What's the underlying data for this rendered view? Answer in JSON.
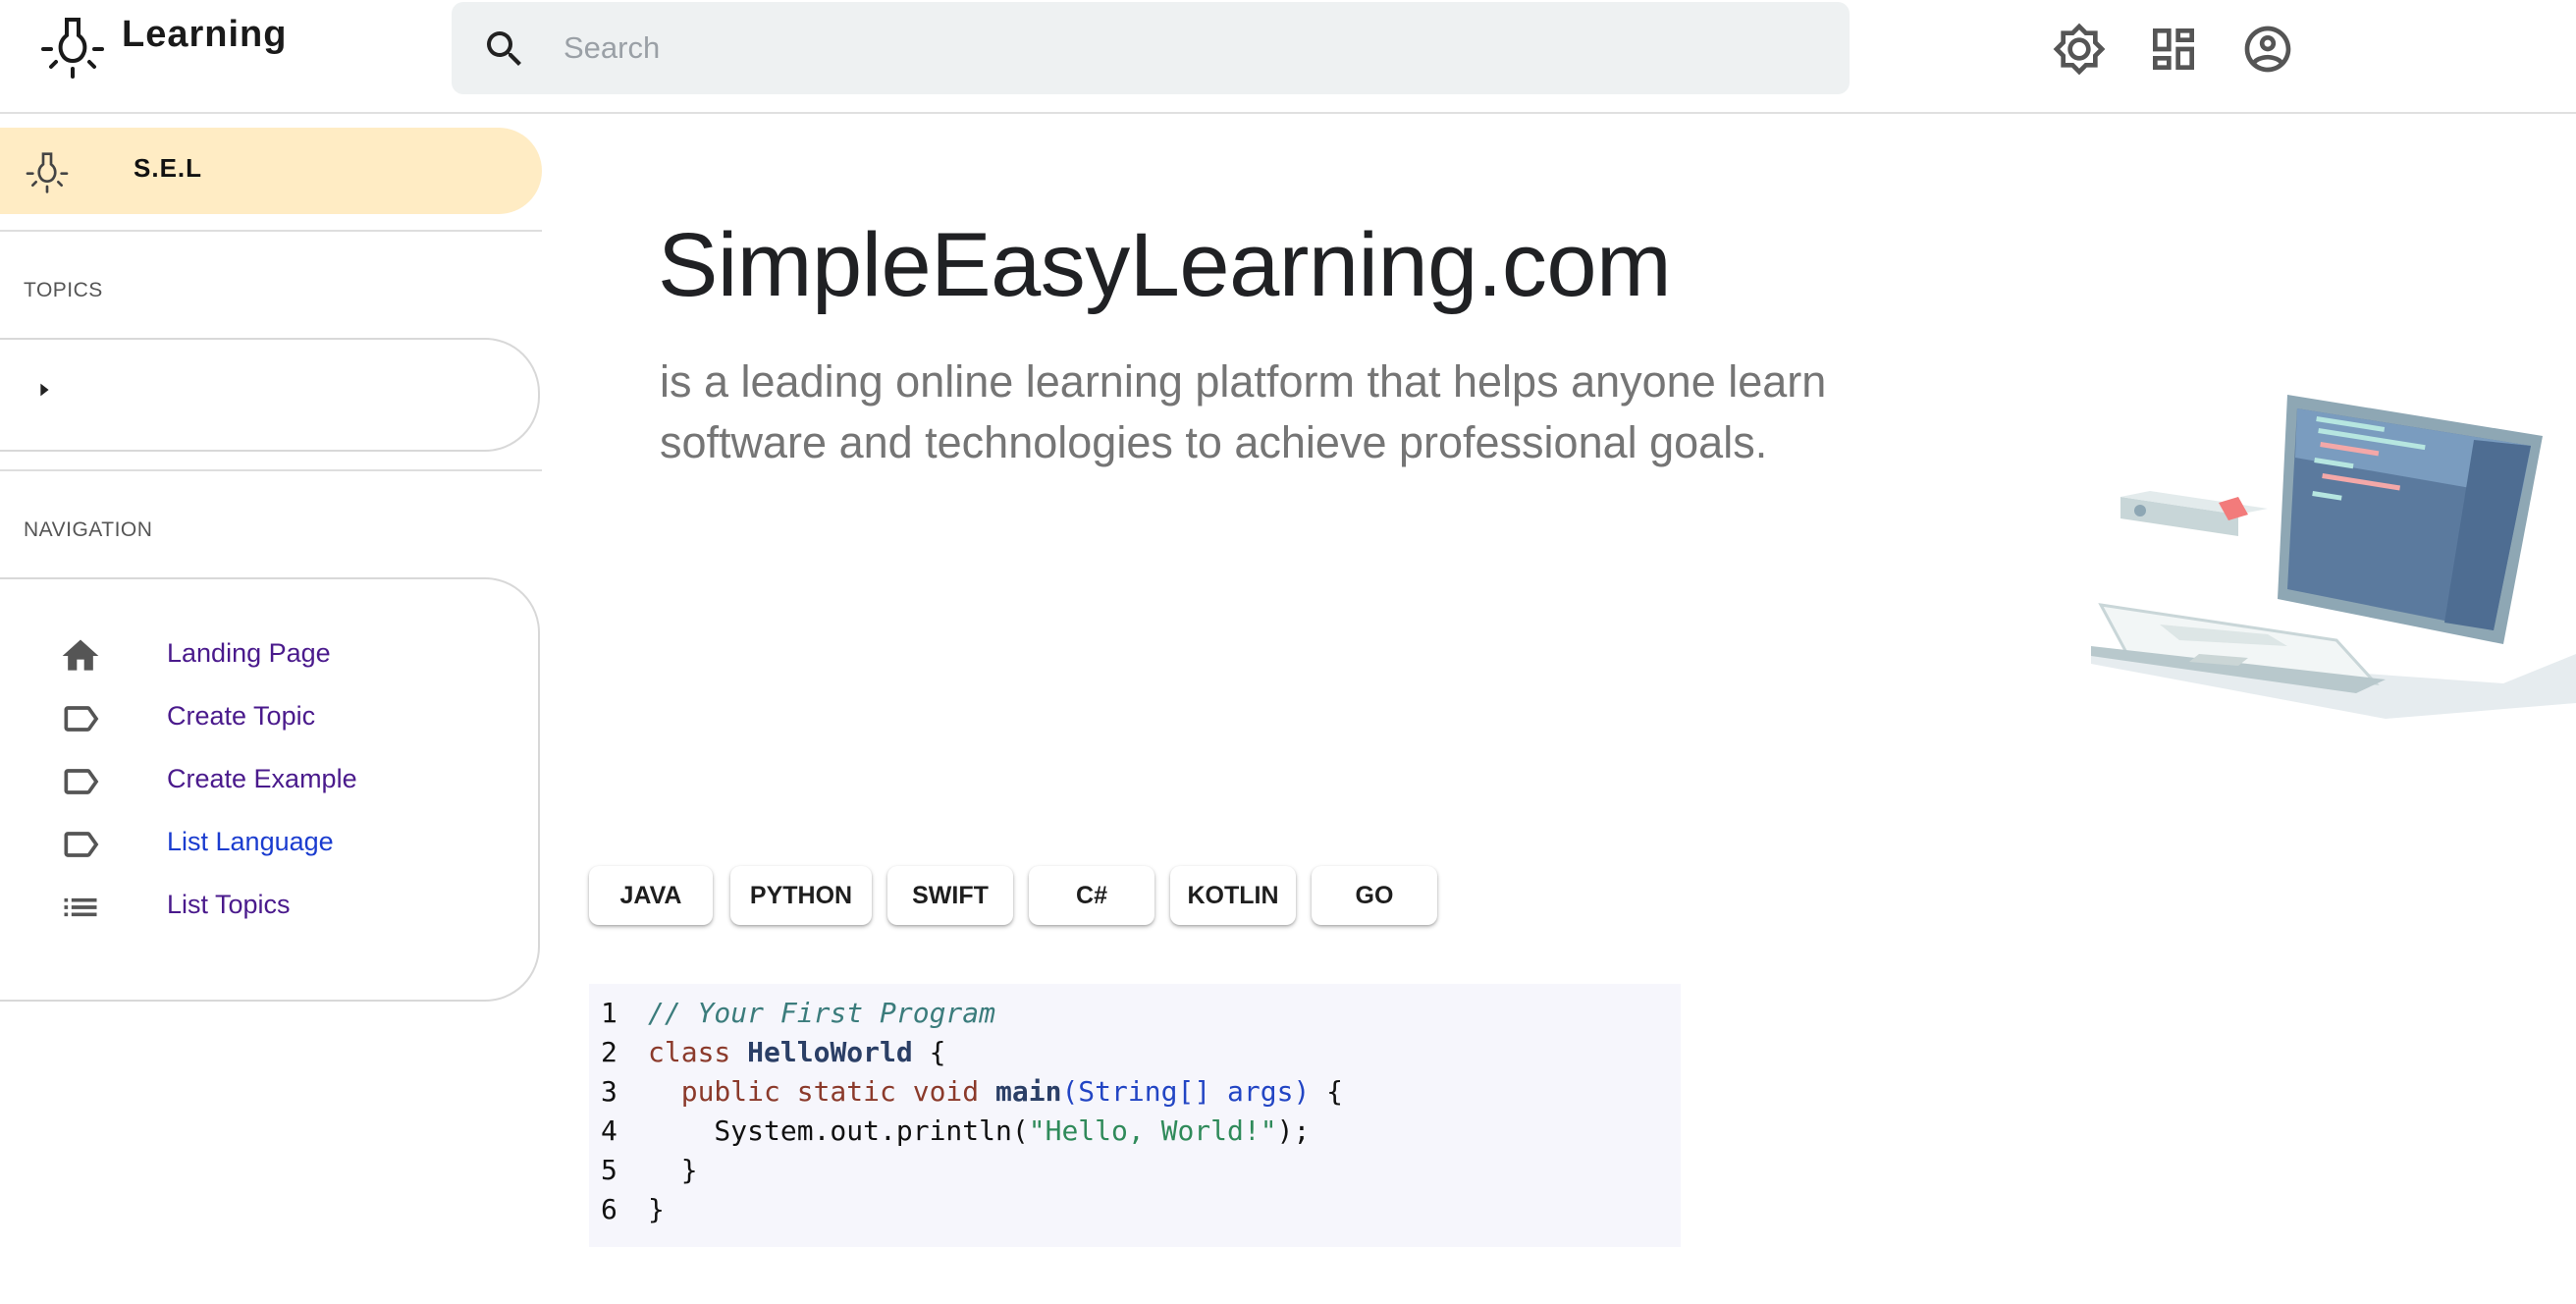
{
  "header": {
    "app_name": "Learning",
    "search": {
      "placeholder": "Search",
      "value": ""
    },
    "icons": [
      "lightbulb-icon",
      "search-icon",
      "brightness-icon",
      "dashboard-icon",
      "account-circle-icon"
    ]
  },
  "sidebar": {
    "brand": {
      "label": "S.E.L",
      "icon": "lightbulb-icon"
    },
    "topics_title": "TOPICS",
    "navigation_title": "NAVIGATION",
    "nav_items": [
      {
        "label": "Landing Page",
        "icon": "home-icon"
      },
      {
        "label": "Create Topic",
        "icon": "label-icon"
      },
      {
        "label": "Create Example",
        "icon": "label-icon"
      },
      {
        "label": "List Language",
        "icon": "label-icon"
      },
      {
        "label": "List Topics",
        "icon": "list-icon"
      }
    ]
  },
  "main": {
    "title": "SimpleEasyLearning.com",
    "subtitle_line1": "is a leading online learning platform that helps anyone learn",
    "subtitle_line2": "software and technologies to achieve professional goals.",
    "languages": [
      "JAVA",
      "PYTHON",
      "SWIFT",
      "C#",
      "KOTLIN",
      "GO"
    ],
    "code": {
      "line_numbers": [
        "1",
        "2",
        "3",
        "4",
        "5",
        "6"
      ],
      "lines": [
        {
          "tokens": [
            {
              "t": "// Your First Program",
              "k": "comment"
            }
          ]
        },
        {
          "tokens": [
            {
              "t": "class ",
              "k": "kw"
            },
            {
              "t": "HelloWorld",
              "k": "cls"
            },
            {
              "t": " {",
              "k": "plain"
            }
          ]
        },
        {
          "tokens": [
            {
              "t": "  public static void ",
              "k": "kw"
            },
            {
              "t": "main",
              "k": "fn"
            },
            {
              "t": "(String[] args)",
              "k": "type"
            },
            {
              "t": " {",
              "k": "plain"
            }
          ]
        },
        {
          "tokens": [
            {
              "t": "    System.out.println(",
              "k": "plain"
            },
            {
              "t": "\"Hello, World!\"",
              "k": "str"
            },
            {
              "t": ");",
              "k": "plain"
            }
          ]
        },
        {
          "tokens": [
            {
              "t": "  }",
              "k": "plain"
            }
          ]
        },
        {
          "tokens": [
            {
              "t": "}",
              "k": "plain"
            }
          ]
        }
      ]
    }
  },
  "colors": {
    "brand_highlight": "#ffecc4",
    "nav_link": "#4a1a8c",
    "nav_link_active": "#1a3ccf",
    "code_background": "#f6f6fc"
  }
}
